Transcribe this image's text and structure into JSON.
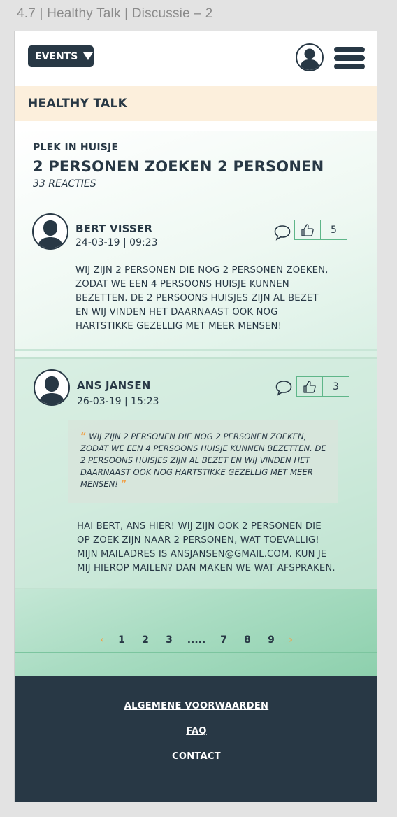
{
  "artboard": {
    "title": "4.7 | Healthy Talk | Discussie – 2"
  },
  "topbar": {
    "events_label": "EVENTS",
    "icons": {
      "dropdown": "caret-down-icon",
      "profile": "user-avatar-icon",
      "menu": "hamburger-menu-icon"
    }
  },
  "section": {
    "title": "HEALTHY TALK"
  },
  "topic": {
    "category": "PLEK IN HUISJE",
    "title": "2 PERSONEN ZOEKEN 2 PERSONEN",
    "reactions": "33 REACTIES"
  },
  "posts": [
    {
      "author": "BERT VISSER",
      "date": "24-03-19 | 09:23",
      "likes": "5",
      "body": "Wij zijn 2 personen die nog 2 personen zoeken, zodat we een 4 persoons huisje kunnen bezetten. De 2 persoons huisjes zijn al bezet en wij vinden het daarnaast ook nog hartstikke gezellig met meer mensen!"
    },
    {
      "author": "ANS JANSEN",
      "date": "26-03-19 | 15:23",
      "likes": "3",
      "quote": "Wij zijn 2 personen die nog 2 personen zoeken, zodat we een 4 persoons huisje kunnen bezetten. De 2 persoons huisjes zijn al bezet en wij vinden het daarnaast ook nog hartstikke gezellig met meer mensen!",
      "body": "Hai Bert, Ans hier! Wij zijn ook 2 personen die op zoek zijn naar 2 personen, wat toevallig! Mijn mailadres is ansjansen@gmail.com. Kun je mij hierop mailen? Dan maken we wat afspraken."
    }
  ],
  "pagination": {
    "prev": "‹",
    "next": "›",
    "pages": [
      "1",
      "2",
      "3",
      ".....",
      "7",
      "8",
      "9"
    ],
    "current": "3"
  },
  "footer": {
    "links": [
      "ALGEMENE VOORWAARDEN",
      "FAQ",
      "CONTACT"
    ]
  },
  "colors": {
    "navy": "#283845",
    "accent_orange": "#f0a24b",
    "accent_green": "#5fb689",
    "section_bg": "#fcefdc"
  }
}
